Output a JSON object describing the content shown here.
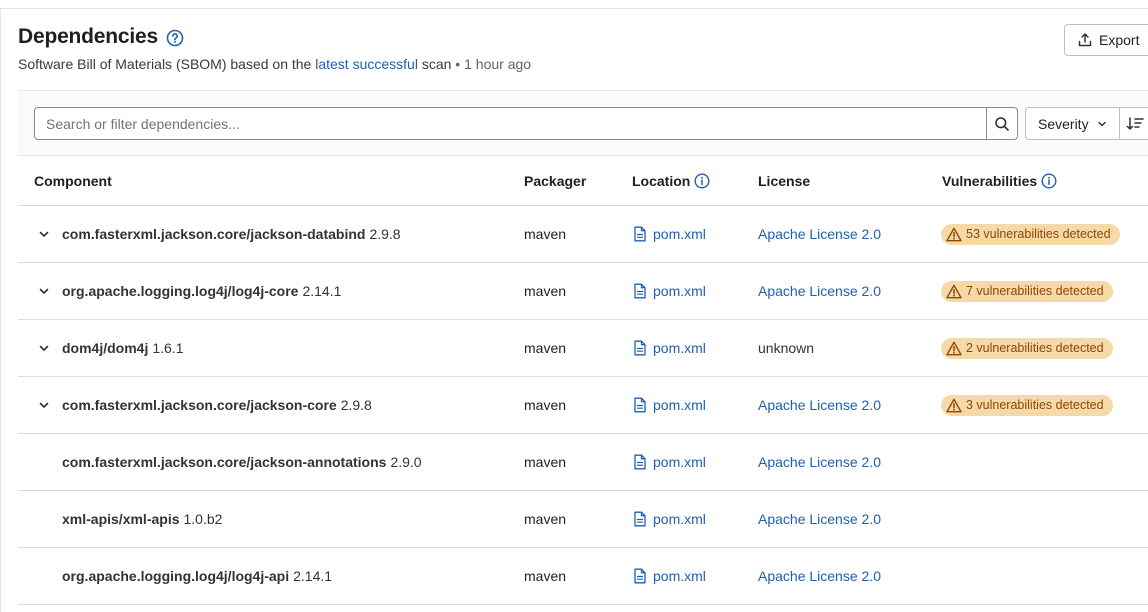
{
  "header": {
    "title": "Dependencies",
    "subtitle_prefix": "Software Bill of Materials (SBOM) based on the ",
    "subtitle_link": "latest successful",
    "subtitle_mid": " scan",
    "subtitle_sep": " • ",
    "subtitle_time": "1 hour ago",
    "export_label": "Export"
  },
  "filter": {
    "search_placeholder": "Search or filter dependencies...",
    "severity_label": "Severity"
  },
  "columns": {
    "component": "Component",
    "packager": "Packager",
    "location": "Location",
    "license": "License",
    "vulnerabilities": "Vulnerabilities"
  },
  "rows": [
    {
      "name": "com.fasterxml.jackson.core/jackson-databind",
      "version": "2.9.8",
      "packager": "maven",
      "location": "pom.xml",
      "license": "Apache License 2.0",
      "vulns": "53 vulnerabilities detected",
      "expandable": true
    },
    {
      "name": "org.apache.logging.log4j/log4j-core",
      "version": "2.14.1",
      "packager": "maven",
      "location": "pom.xml",
      "license": "Apache License 2.0",
      "vulns": "7 vulnerabilities detected",
      "expandable": true
    },
    {
      "name": "dom4j/dom4j",
      "version": "1.6.1",
      "packager": "maven",
      "location": "pom.xml",
      "license": "unknown",
      "vulns": "2 vulnerabilities detected",
      "expandable": true
    },
    {
      "name": "com.fasterxml.jackson.core/jackson-core",
      "version": "2.9.8",
      "packager": "maven",
      "location": "pom.xml",
      "license": "Apache License 2.0",
      "vulns": "3 vulnerabilities detected",
      "expandable": true
    },
    {
      "name": "com.fasterxml.jackson.core/jackson-annotations",
      "version": "2.9.0",
      "packager": "maven",
      "location": "pom.xml",
      "license": "Apache License 2.0",
      "vulns": "",
      "expandable": false
    },
    {
      "name": "xml-apis/xml-apis",
      "version": "1.0.b2",
      "packager": "maven",
      "location": "pom.xml",
      "license": "Apache License 2.0",
      "vulns": "",
      "expandable": false
    },
    {
      "name": "org.apache.logging.log4j/log4j-api",
      "version": "2.14.1",
      "packager": "maven",
      "location": "pom.xml",
      "license": "Apache License 2.0",
      "vulns": "",
      "expandable": false
    }
  ],
  "colors": {
    "link": "#1f5fb0",
    "badge_bg": "#f5d9a8",
    "badge_text": "#8f4700"
  }
}
